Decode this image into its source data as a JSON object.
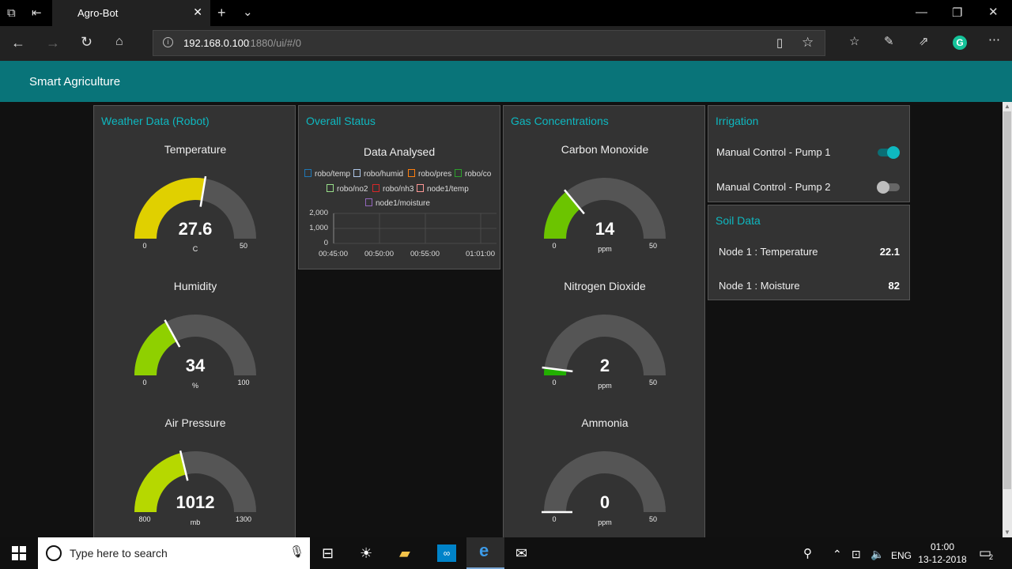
{
  "browser": {
    "tab_title": "Agro-Bot",
    "url_host": "192.168.0.100",
    "url_path": ":1880/ui/#/0",
    "grammarly_letter": "G"
  },
  "app": {
    "title": "Smart Agriculture"
  },
  "weather": {
    "title": "Weather Data (Robot)",
    "gauges": [
      {
        "title": "Temperature",
        "value": "27.6",
        "unit": "C",
        "min": "0",
        "max": "50",
        "level": 0.552,
        "color": "#e0d000"
      },
      {
        "title": "Humidity",
        "value": "34",
        "unit": "%",
        "min": "0",
        "max": "100",
        "level": 0.34,
        "color": "#8fd000"
      },
      {
        "title": "Air Pressure",
        "value": "1012",
        "unit": "mb",
        "min": "800",
        "max": "1300",
        "level": 0.424,
        "color": "#b6d800"
      }
    ]
  },
  "status": {
    "title": "Overall Status",
    "chart_data": {
      "type": "line",
      "title": "Data Analysed",
      "series": [
        {
          "name": "robo/temp",
          "color": "#1f77b4",
          "values": []
        },
        {
          "name": "robo/humid",
          "color": "#aec7e8",
          "values": []
        },
        {
          "name": "robo/pres",
          "color": "#ff7f0e",
          "values": []
        },
        {
          "name": "robo/co",
          "color": "#2ca02c",
          "values": []
        },
        {
          "name": "robo/no2",
          "color": "#98df8a",
          "values": []
        },
        {
          "name": "robo/nh3",
          "color": "#d62728",
          "values": []
        },
        {
          "name": "node1/temp",
          "color": "#ff9896",
          "values": []
        },
        {
          "name": "node1/moisture",
          "color": "#9467bd",
          "values": []
        }
      ],
      "y_ticks": [
        "2,000",
        "1,000",
        "0"
      ],
      "x_ticks": [
        "00:45:00",
        "00:50:00",
        "00:55:00",
        "01:01:00"
      ],
      "ylim": [
        0,
        2000
      ]
    }
  },
  "gas": {
    "title": "Gas Concentrations",
    "gauges": [
      {
        "title": "Carbon Monoxide",
        "value": "14",
        "unit": "ppm",
        "min": "0",
        "max": "50",
        "level": 0.28,
        "color": "#6cc400"
      },
      {
        "title": "Nitrogen Dioxide",
        "value": "2",
        "unit": "ppm",
        "min": "0",
        "max": "50",
        "level": 0.04,
        "color": "#22b000"
      },
      {
        "title": "Ammonia",
        "value": "0",
        "unit": "ppm",
        "min": "0",
        "max": "50",
        "level": 0.0,
        "color": "#22b000"
      }
    ]
  },
  "irrigation": {
    "title": "Irrigation",
    "pumps": [
      {
        "label": "Manual Control - Pump 1",
        "on": true
      },
      {
        "label": "Manual Control - Pump 2",
        "on": false
      }
    ]
  },
  "soil": {
    "title": "Soil Data",
    "rows": [
      {
        "label": "Node 1 : Temperature",
        "value": "22.1"
      },
      {
        "label": "Node 1 : Moisture",
        "value": "82"
      }
    ]
  },
  "taskbar": {
    "search_placeholder": "Type here to search",
    "language": "ENG",
    "time": "01:00",
    "date": "13-12-2018",
    "notification_count": "2"
  },
  "colors": {
    "header": "#097479",
    "accent": "#0eb8c0",
    "card": "#333333",
    "gauge_track": "#555555"
  }
}
